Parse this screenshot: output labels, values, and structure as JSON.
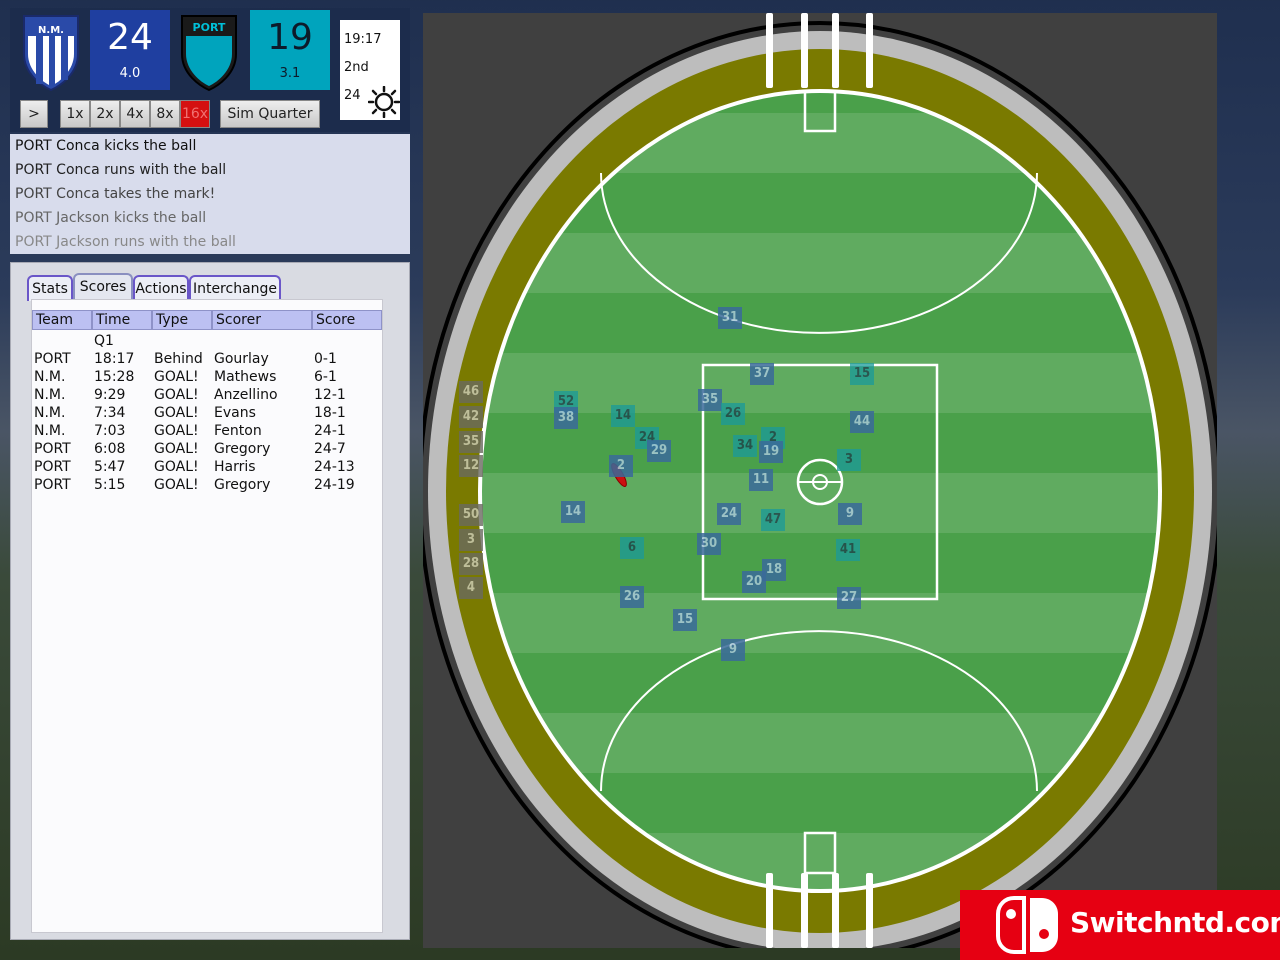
{
  "scoreboard": {
    "home": {
      "abbr": "N.M.",
      "total": "24",
      "detail": "4.0",
      "color": "#1f3fa0"
    },
    "away": {
      "abbr": "PORT",
      "total": "19",
      "detail": "3.1",
      "color": "#00a4bd"
    },
    "clock": "19:17",
    "quarter": "2nd",
    "temperature": "24",
    "weather_icon": "sun-icon"
  },
  "controls": {
    "play_label": ">",
    "speeds": [
      "1x",
      "2x",
      "4x",
      "8x",
      "16x"
    ],
    "active_speed": "16x",
    "sim_label": "Sim Quarter"
  },
  "commentary": [
    "PORT Conca kicks the ball",
    "PORT Conca runs with the ball",
    "PORT Conca takes the mark!",
    "PORT Jackson kicks the ball",
    "PORT Jackson runs with the ball"
  ],
  "tabs": [
    {
      "label": "Stats"
    },
    {
      "label": "Scores"
    },
    {
      "label": "Actions"
    },
    {
      "label": "Interchange"
    }
  ],
  "active_tab": "Scores",
  "scores_table": {
    "headers": [
      "Team",
      "Time",
      "Type",
      "Scorer",
      "Score"
    ],
    "quarter_label": "Q1",
    "rows": [
      [
        "PORT",
        "18:17",
        "Behind",
        "Gourlay",
        "0-1"
      ],
      [
        "N.M.",
        "15:28",
        "GOAL!",
        "Mathews",
        "6-1"
      ],
      [
        "N.M.",
        "9:29",
        "GOAL!",
        "Anzellino",
        "12-1"
      ],
      [
        "N.M.",
        "7:34",
        "GOAL!",
        "Evans",
        "18-1"
      ],
      [
        "N.M.",
        "7:03",
        "GOAL!",
        "Fenton",
        "24-1"
      ],
      [
        "PORT",
        "6:08",
        "GOAL!",
        "Gregory",
        "24-7"
      ],
      [
        "PORT",
        "5:47",
        "GOAL!",
        "Harris",
        "24-13"
      ],
      [
        "PORT",
        "5:15",
        "GOAL!",
        "Gregory",
        "24-19"
      ]
    ]
  },
  "players": [
    "31",
    "37",
    "15",
    "35",
    "26",
    "44",
    "52",
    "38",
    "14",
    "24",
    "29",
    "34",
    "2",
    "19",
    "3",
    "2",
    "11",
    "14",
    "24",
    "47",
    "9",
    "6",
    "30",
    "41",
    "18",
    "20",
    "26",
    "27",
    "15",
    "9"
  ],
  "bench_players": [
    "46",
    "42",
    "35",
    "12",
    "50",
    "3",
    "28",
    "4"
  ],
  "colors": {
    "grass": "#4aa04a",
    "track": "#7a7a00",
    "fence": "#b4b4b4",
    "ball": "#cc1010"
  },
  "brand": {
    "text": "Switchntd.com"
  }
}
